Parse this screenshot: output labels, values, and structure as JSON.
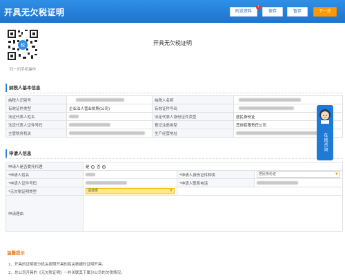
{
  "header": {
    "title": "开具无欠税证明",
    "buttons": {
      "attachments": "附送资料",
      "save": "保存",
      "draft": "暂存",
      "next": "下一步"
    },
    "badge": "!"
  },
  "qr": {
    "caption": "扫一扫手机操作"
  },
  "document_title": "开具无欠税证明",
  "taxpayer_section": {
    "title": "纳税人基本信息",
    "rows": [
      {
        "l1": "纳税人识别号",
        "v1": "",
        "l2": "纳税人名称",
        "v2": ""
      },
      {
        "l1": "有效证件类型",
        "v1": "企业法人营业执照(公司)",
        "l2": "有效证件号码",
        "v2": ""
      },
      {
        "l1": "法定代表人姓名",
        "v1": "",
        "l2": "法定代表人身份证件类型",
        "v2": "居民身份证"
      },
      {
        "l1": "法定代表人证件号码",
        "v1": "",
        "l2": "登记注册类型",
        "v2": "其他有限责任公司"
      },
      {
        "l1": "主管税务机关",
        "v1": "",
        "l2": "生产经营地址",
        "v2": ""
      }
    ]
  },
  "applicant_section": {
    "title": "申请人信息",
    "is_agent_label": "申请人是否委托代理",
    "yes": "是",
    "no": "否",
    "name_label": "*申请人姓名",
    "id_type_label": "*申请人身份证件种类",
    "id_type_value": "居民身份证",
    "id_no_label": "*申请人证件号码",
    "phone_label": "*申请人联系电话",
    "cert_type_label": "*无欠税证明类型",
    "cert_type_value": "请选择",
    "reason_label": "申请理由"
  },
  "side_widget": {
    "text": "在线咨询"
  },
  "tips": {
    "title": "温馨提示",
    "items": [
      "1、开具的证明按分机关按照开具的有关数据时证明开具。",
      "2、总公司开具的《无欠税证明》一并关联其下属分公司的欠税情况。"
    ]
  },
  "colors": {
    "header": "#1d74d0",
    "accent": "#ff9800",
    "tips": "#e67e22"
  }
}
